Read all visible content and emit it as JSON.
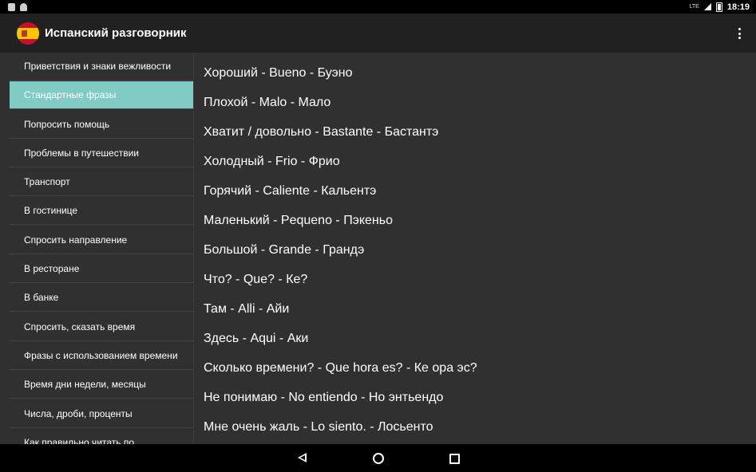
{
  "status_bar": {
    "network": "LTE",
    "time": "18:19"
  },
  "app_bar": {
    "title": "Испанский разговорник"
  },
  "sidebar": {
    "items": [
      {
        "label": "Приветствия и знаки вежливости",
        "active": false
      },
      {
        "label": "Стандартные фразы",
        "active": true
      },
      {
        "label": "Попросить помощь",
        "active": false
      },
      {
        "label": "Проблемы в путешествии",
        "active": false
      },
      {
        "label": "Транспорт",
        "active": false
      },
      {
        "label": "В гостинице",
        "active": false
      },
      {
        "label": "Спросить направление",
        "active": false
      },
      {
        "label": "В ресторане",
        "active": false
      },
      {
        "label": "В банке",
        "active": false
      },
      {
        "label": "Спросить, сказать время",
        "active": false
      },
      {
        "label": "Фразы с использованием времени",
        "active": false
      },
      {
        "label": "Время дни недели, месяцы",
        "active": false
      },
      {
        "label": "Числа, дроби, проценты",
        "active": false
      },
      {
        "label": "Как правильно читать по",
        "active": false
      }
    ]
  },
  "phrases": [
    "Хороший - Bueno - Буэно",
    "Плохой - Malo - Мало",
    "Хватит / довольно - Bastante - Бастантэ",
    "Холодный - Frio - Фрио",
    "Горячий - Caliente - Кальентэ",
    "Маленький - Pequeno - Пэкеньо",
    "Большой - Grande - Грандэ",
    "Что? - Que? - Ке?",
    "Там - Alli - Айи",
    "Здесь - Aqui - Аки",
    "Сколько времени? - Que hora es? - Ке ора эс?",
    "Не понимаю - No entiendo - Но энтьендо",
    "Мне очень жаль - Lo siento. - Лосьенто"
  ],
  "colors": {
    "active_item": "#80cbc4",
    "app_bar": "#212121",
    "background": "#303030"
  }
}
